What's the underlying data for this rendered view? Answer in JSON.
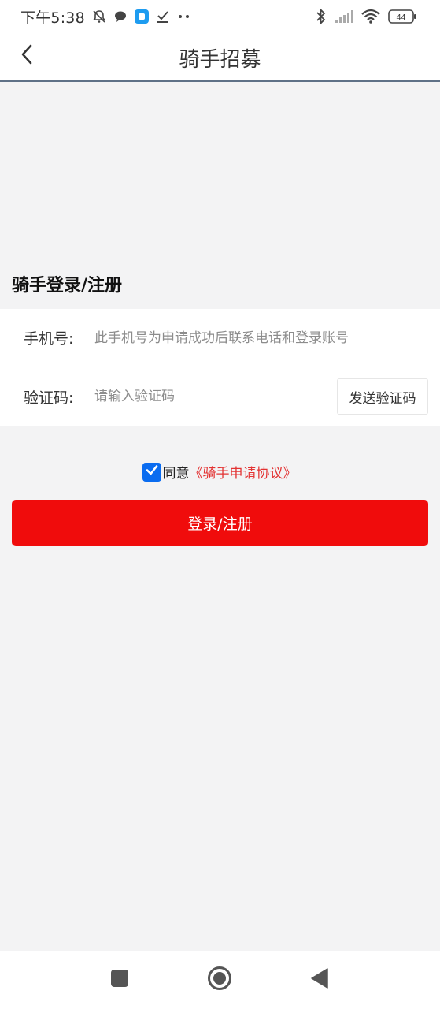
{
  "status_bar": {
    "time": "下午5:38",
    "left_icons": [
      "mute-bell-icon",
      "chat-bubble-icon",
      "app-notification-icon",
      "download-check-icon",
      "more-dots-icon"
    ],
    "right_icons": [
      "bluetooth-icon",
      "signal-icon",
      "wifi-icon",
      "battery-icon"
    ],
    "battery_level": "44"
  },
  "header": {
    "title": "骑手招募",
    "back_icon": "chevron-left-icon"
  },
  "section": {
    "title": "骑手登录/注册"
  },
  "form": {
    "phone_label": "手机号:",
    "phone_placeholder": "此手机号为申请成功后联系电话和登录账号",
    "phone_value": "",
    "code_label": "验证码:",
    "code_placeholder": "请输入验证码",
    "code_value": "",
    "send_code_label": "发送验证码"
  },
  "agreement": {
    "checked": true,
    "prefix": "同意",
    "link_text": "《骑手申请协议》"
  },
  "login_button": {
    "label": "登录/注册"
  },
  "nav_bar": {
    "icons": [
      "recent-apps-icon",
      "home-icon",
      "back-triangle-icon"
    ]
  },
  "colors": {
    "primary_red": "#f00c0c",
    "link_red": "#e33232",
    "checkbox_blue": "#0a6cf0",
    "background": "#f3f3f4"
  }
}
